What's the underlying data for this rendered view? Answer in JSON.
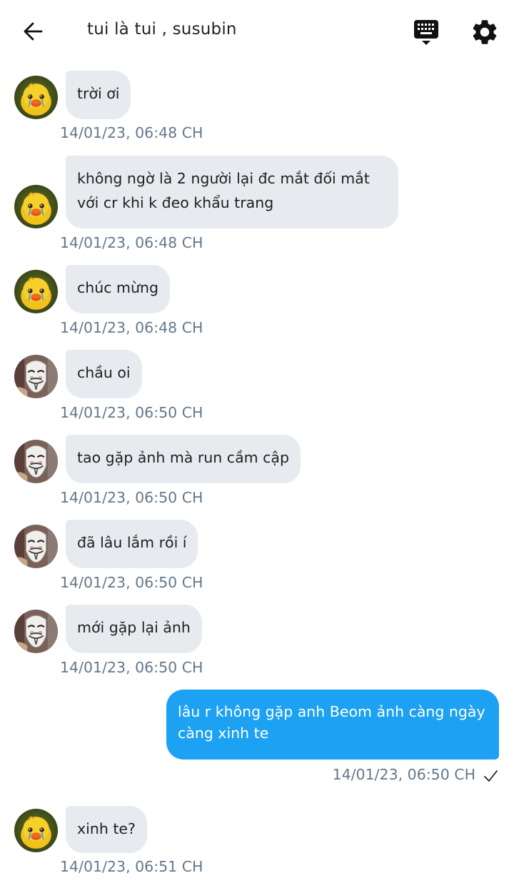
{
  "header": {
    "title": "tui là tui ,  susubin"
  },
  "messages": [
    {
      "avatar": "duck-avatar",
      "text": "trời ơi",
      "time": "14/01/23,  06:48 CH"
    },
    {
      "avatar": "duck-avatar",
      "text_lines": [
        "không ngờ là 2 người lại đc mắt đối mắt",
        "với cr khi k đeo khẩu trang"
      ],
      "time": "14/01/23,  06:48 CH"
    },
    {
      "avatar": "duck-avatar",
      "text": "chúc mừng",
      "time": "14/01/23,  06:48 CH"
    },
    {
      "avatar": "mask-avatar",
      "text": "chầu oi",
      "time": "14/01/23,  06:50 CH"
    },
    {
      "avatar": "mask-avatar",
      "text": "tao gặp ảnh mà run cầm cập",
      "time": "14/01/23,  06:50 CH"
    },
    {
      "avatar": "mask-avatar",
      "text": "đã lâu lắm rồi í",
      "time": "14/01/23,  06:50 CH"
    },
    {
      "avatar": "mask-avatar",
      "text": "mới gặp lại ảnh",
      "time": "14/01/23,  06:50 CH"
    },
    {
      "direction": "outgoing",
      "text_lines": [
        "lâu r không gặp anh Beom ảnh càng ngày",
        "càng xinh te"
      ],
      "time": "14/01/23,  06:50 CH",
      "status_icon": "check-icon"
    },
    {
      "avatar": "duck-avatar",
      "text": "xinh te?",
      "time": "14/01/23,  06:51 CH"
    }
  ],
  "colors": {
    "incoming_bubble": "#e7ebef",
    "outgoing_bubble": "#1da1f2",
    "timestamp": "#64788a"
  }
}
